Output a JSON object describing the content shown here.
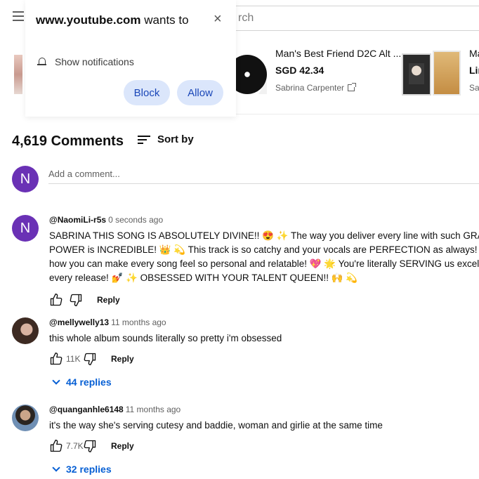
{
  "popup": {
    "site": "www.youtube.com",
    "title_suffix": " wants to",
    "permission": "Show notifications",
    "block_label": "Block",
    "allow_label": "Allow",
    "close_glyph": "×"
  },
  "search": {
    "placeholder_fragment": "rch"
  },
  "merch": {
    "item1": {
      "title": "Man's Best Friend D2C Alt ...",
      "price": "SGD 42.34",
      "seller": "Sabrina Carpenter"
    },
    "item2": {
      "title": "Ma",
      "price": "Lir",
      "seller": "Sal"
    }
  },
  "comments_header": {
    "count": "4,619 Comments",
    "sort_label": "Sort by"
  },
  "add_comment": {
    "avatar_letter": "N",
    "placeholder": "Add a comment..."
  },
  "comments": [
    {
      "avatar_letter": "N",
      "author": "@NaomiLi-r5s",
      "time": "0 seconds ago",
      "lines": [
        "SABRINA THIS SONG IS ABSOLUTELY DIVINE!! 😍 ✨ The way you deliver every line with such GRACE a",
        "POWER is INCREDIBLE! 👑 💫 This track is so catchy and your vocals are PERFECTION as always! 🎵 🔥",
        "how you can make every song feel so personal and relatable! 💖 🌟 You're literally SERVING us exceller",
        "every release! 💅 ✨ OBSESSED WITH YOUR TALENT QUEEN!! 🙌 💫"
      ],
      "likes": "",
      "reply_label": "Reply"
    },
    {
      "author": "@mellywelly13",
      "time": "11 months ago",
      "lines": [
        "this whole album sounds literally so pretty i'm obsessed"
      ],
      "likes": "11K",
      "reply_label": "Reply",
      "replies": "44 replies"
    },
    {
      "author": "@quanganhle6148",
      "time": "11 months ago",
      "lines": [
        "it's the way she's serving cutesy and baddie, woman and girlie at the same time"
      ],
      "likes": "7.7K",
      "reply_label": "Reply",
      "replies": "32 replies"
    }
  ],
  "colors": {
    "avatar_purple": "#6a31b5",
    "link_blue": "#065fd4",
    "popup_button_bg": "#dbe6fb"
  }
}
